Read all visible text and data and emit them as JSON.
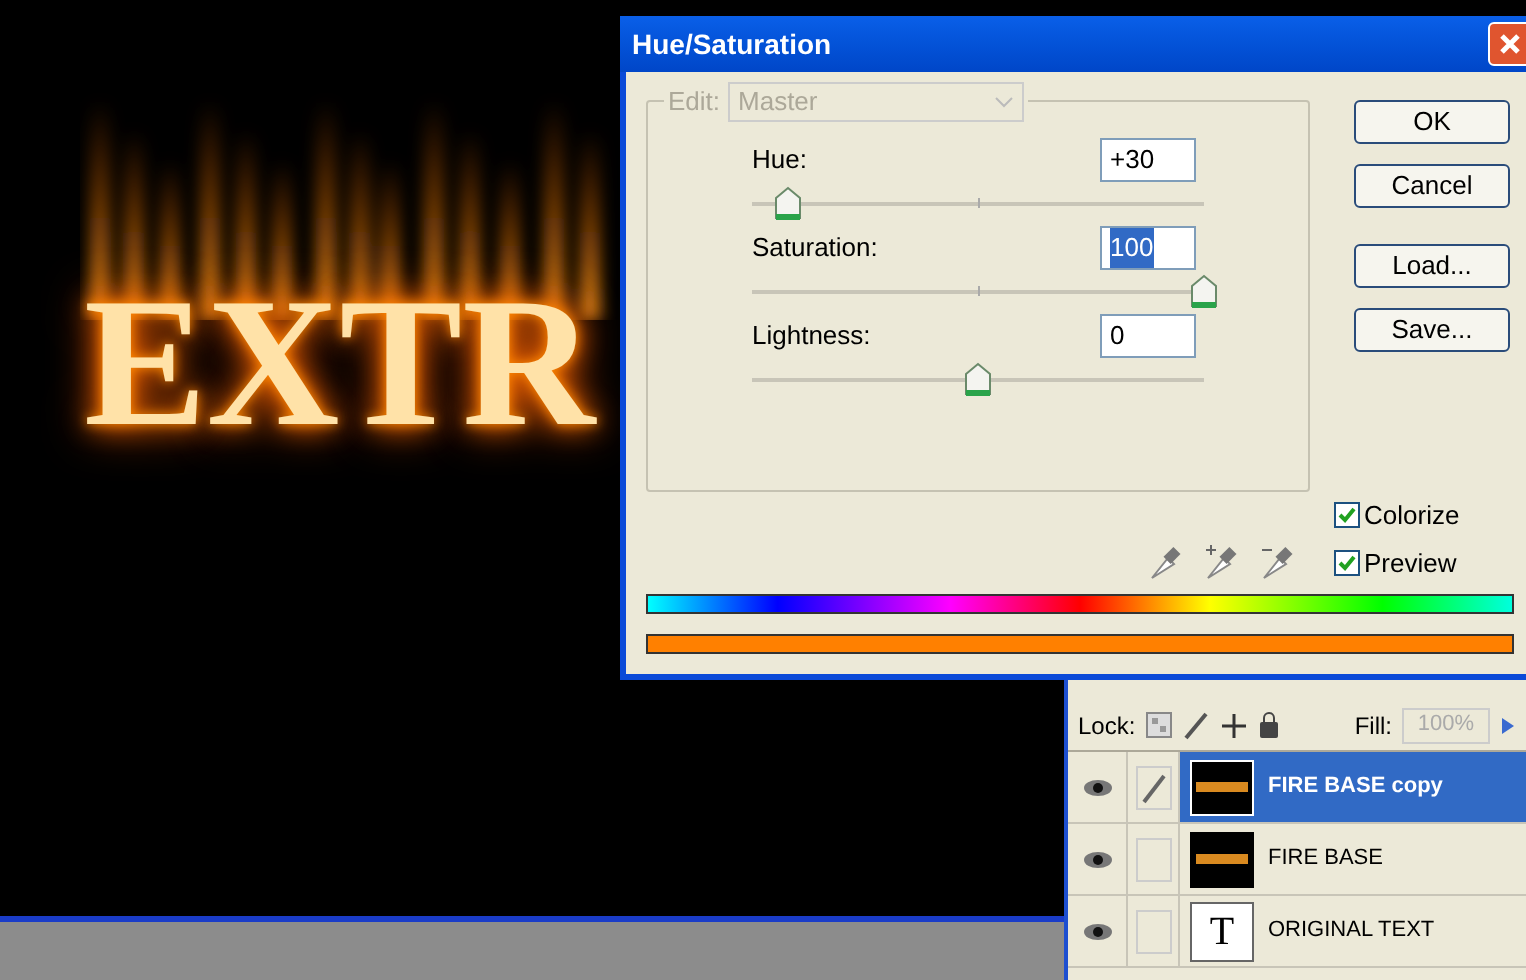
{
  "canvas": {
    "text": "EXTR"
  },
  "dialog": {
    "title": "Hue/Saturation",
    "edit": {
      "label": "Edit:",
      "value": "Master",
      "disabled": true
    },
    "sliders": [
      {
        "label": "Hue:",
        "value": "+30",
        "highlighted": false,
        "level": 0.08
      },
      {
        "label": "Saturation:",
        "value": "100",
        "highlighted": true,
        "level": 1
      },
      {
        "label": "Lightness:",
        "value": "0",
        "highlighted": false,
        "level": 0.5
      }
    ],
    "buttons": [
      "OK",
      "Cancel",
      "Load...",
      "Save..."
    ],
    "checkboxes": [
      {
        "label": "Colorize",
        "checked": true
      },
      {
        "label": "Preview",
        "checked": true
      }
    ]
  },
  "layers": {
    "lock_label": "Lock:",
    "fill_label": "Fill:",
    "fill_value": "100%",
    "items": [
      {
        "name": "FIRE BASE copy",
        "selected": true,
        "brush": true,
        "kind": "image"
      },
      {
        "name": "FIRE BASE",
        "selected": false,
        "brush": false,
        "kind": "image"
      },
      {
        "name": "ORIGINAL TEXT",
        "selected": false,
        "brush": false,
        "kind": "text",
        "glyph": "T"
      }
    ]
  }
}
